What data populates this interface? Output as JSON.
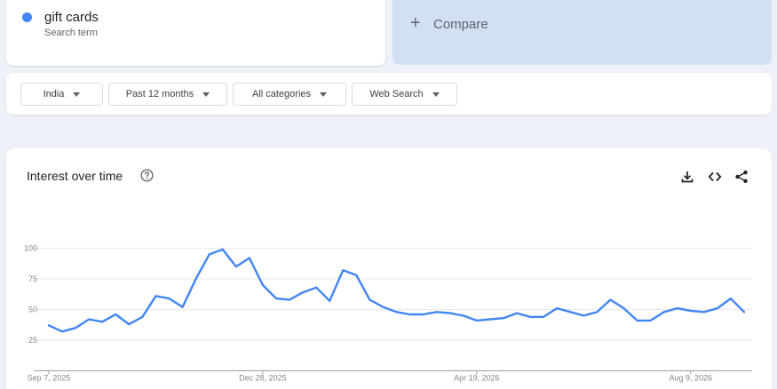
{
  "term": {
    "name": "gift cards",
    "subtitle": "Search term",
    "color": "#4285f4"
  },
  "compare": {
    "label": "Compare",
    "icon": "plus-icon"
  },
  "filters": [
    {
      "label": "India",
      "icon": "caret-down-icon"
    },
    {
      "label": "Past 12 months",
      "icon": "caret-down-icon"
    },
    {
      "label": "All categories",
      "icon": "caret-down-icon"
    },
    {
      "label": "Web Search",
      "icon": "caret-down-icon"
    }
  ],
  "interest": {
    "title": "Interest over time",
    "icons": [
      "help-icon",
      "download-icon",
      "embed-icon",
      "share-icon"
    ]
  },
  "chart_data": {
    "type": "line",
    "x_tick_labels": [
      "Sep 7, 2025",
      "Dec 28, 2025",
      "Apr 19, 2026",
      "Aug 9, 2026"
    ],
    "y_ticks": [
      25,
      50,
      75,
      100
    ],
    "ylim": [
      0,
      100
    ],
    "grid": true,
    "series": [
      {
        "color": "#4285f4",
        "values": [
          37,
          32,
          35,
          42,
          40,
          46,
          38,
          44,
          61,
          59,
          52,
          75,
          95,
          99,
          85,
          92,
          70,
          59,
          58,
          64,
          68,
          57,
          82,
          78,
          58,
          52,
          48,
          46,
          46,
          48,
          47,
          45,
          41,
          42,
          43,
          47,
          44,
          44,
          51,
          48,
          45,
          48,
          58,
          51,
          41,
          41,
          48,
          51,
          49,
          48,
          51,
          59,
          48
        ]
      }
    ]
  }
}
